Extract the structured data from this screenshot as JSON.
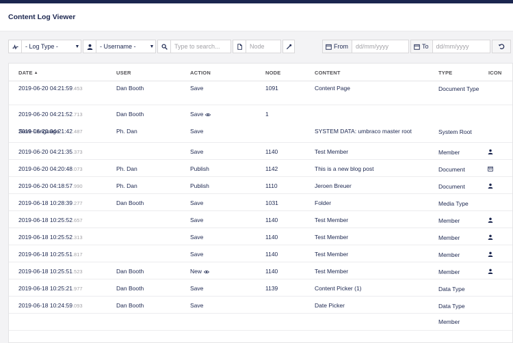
{
  "header": {
    "title": "Content Log Viewer"
  },
  "filters": {
    "log_type": "- Log Type -",
    "username": "- Username -",
    "search_placeholder": "Type to search...",
    "node_placeholder": "Node",
    "from_label": "From",
    "from_placeholder": "dd/mm/yyyy",
    "to_label": "To",
    "to_placeholder": "dd/mm/yyyy"
  },
  "table": {
    "columns": [
      "DATE",
      "USER",
      "ACTION",
      "NODE",
      "CONTENT",
      "TYPE",
      "ICON"
    ],
    "rows": [
      {
        "date": "2019-06-20 04:21:59",
        "ms": ".453",
        "user": "Dan Booth",
        "action": "Save",
        "eye": false,
        "node": "1091",
        "content": "Content Page",
        "type": "Document Type",
        "icon": ""
      },
      {
        "date": "2019-06-20 04:21:52",
        "ms": ".713",
        "user": "Dan Booth",
        "action": "Save",
        "eye": true,
        "node": "1",
        "content": "",
        "type": "",
        "icon": "",
        "comment": "Save Language"
      },
      {
        "date": "2019-06-20 04:21:42",
        "ms": ".487",
        "user": "Ph. Dan",
        "action": "Save",
        "eye": false,
        "node": "",
        "content": "SYSTEM DATA: umbraco master root",
        "type": "System Root",
        "icon": ""
      },
      {
        "date": "2019-06-20 04:21:35",
        "ms": ".373",
        "user": "",
        "action": "Save",
        "eye": false,
        "node": "1140",
        "content": "Test Member",
        "type": "Member",
        "icon": "user-icon"
      },
      {
        "date": "2019-06-20 04:20:48",
        "ms": ".073",
        "user": "Ph. Dan",
        "action": "Publish",
        "eye": false,
        "node": "1142",
        "content": "This is a new blog post",
        "type": "Document",
        "icon": "calendar-icon"
      },
      {
        "date": "2019-06-20 04:18:57",
        "ms": ".990",
        "user": "Ph. Dan",
        "action": "Publish",
        "eye": false,
        "node": "1110",
        "content": "Jeroen Breuer",
        "type": "Document",
        "icon": "user-icon"
      },
      {
        "date": "2019-06-18 10:28:39",
        "ms": ".277",
        "user": "Dan Booth",
        "action": "Save",
        "eye": false,
        "node": "1031",
        "content": "Folder",
        "type": "Media Type",
        "icon": ""
      },
      {
        "date": "2019-06-18 10:25:52",
        "ms": ".657",
        "user": "",
        "action": "Save",
        "eye": false,
        "node": "1140",
        "content": "Test Member",
        "type": "Member",
        "icon": "user-icon"
      },
      {
        "date": "2019-06-18 10:25:52",
        "ms": ".313",
        "user": "",
        "action": "Save",
        "eye": false,
        "node": "1140",
        "content": "Test Member",
        "type": "Member",
        "icon": "user-icon"
      },
      {
        "date": "2019-06-18 10:25:51",
        "ms": ".817",
        "user": "",
        "action": "Save",
        "eye": false,
        "node": "1140",
        "content": "Test Member",
        "type": "Member",
        "icon": "user-icon"
      },
      {
        "date": "2019-06-18 10:25:51",
        "ms": ".523",
        "user": "Dan Booth",
        "action": "New",
        "eye": true,
        "node": "1140",
        "content": "Test Member",
        "type": "Member",
        "icon": "user-icon"
      },
      {
        "date": "2019-06-18 10:25:21",
        "ms": ".977",
        "user": "Dan Booth",
        "action": "Save",
        "eye": false,
        "node": "1139",
        "content": "Content Picker (1)",
        "type": "Data Type",
        "icon": ""
      },
      {
        "date": "2019-06-18 10:24:59",
        "ms": ".093",
        "user": "Dan Booth",
        "action": "Save",
        "eye": false,
        "node": "",
        "content": "Date Picker",
        "type": "Data Type",
        "icon": ""
      },
      {
        "date": "",
        "ms": "",
        "user": "",
        "action": "",
        "eye": false,
        "node": "",
        "content": "",
        "type": "Member",
        "icon": ""
      }
    ]
  },
  "colors": {
    "topbar": "#1b264f",
    "text": "#1b264f",
    "muted": "#a2a1a6"
  }
}
